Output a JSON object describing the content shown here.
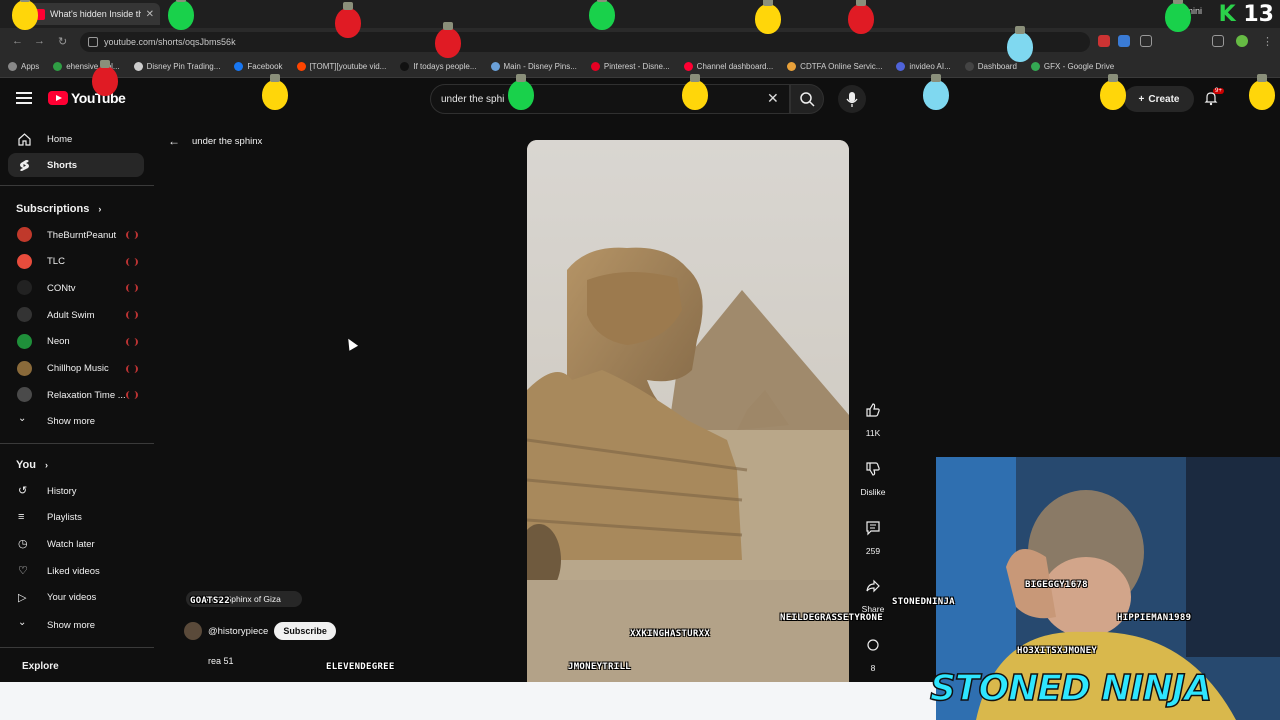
{
  "browser": {
    "tab_title": "What's hidden Inside th",
    "url": "youtube.com/shorts/oqsJbms56k",
    "gemini_label": "Gemini",
    "overlay_counter": "13",
    "bookmarks": [
      {
        "label": "Apps"
      },
      {
        "label": "ehensive Gol..."
      },
      {
        "label": "Disney Pin Trading..."
      },
      {
        "label": "Facebook"
      },
      {
        "label": "[TOMT][youtube vid..."
      },
      {
        "label": "If todays people..."
      },
      {
        "label": "Main - Disney Pins..."
      },
      {
        "label": "Pinterest - Disne..."
      },
      {
        "label": "Channel dashboard..."
      },
      {
        "label": "CDTFA Online Servic..."
      },
      {
        "label": "invideo AI..."
      },
      {
        "label": "Dashboard"
      },
      {
        "label": "GFX - Google Drive"
      }
    ]
  },
  "youtube": {
    "logo_text": "YouTube",
    "search_value": "under the sphi",
    "create_label": "Create",
    "notif_badge": "9+"
  },
  "sidebar": {
    "top": [
      {
        "label": "Home",
        "icon": "home-icon"
      },
      {
        "label": "Shorts",
        "icon": "shorts-icon",
        "active": true
      }
    ],
    "subscriptions_header": "Subscriptions",
    "subscriptions": [
      {
        "label": "TheBurntPeanut",
        "color": "#c0392b"
      },
      {
        "label": "TLC",
        "color": "#e74c3c"
      },
      {
        "label": "CONtv",
        "color": "#222222"
      },
      {
        "label": "Adult Swim",
        "color": "#333333"
      },
      {
        "label": "Neon",
        "color": "#1f8f3a"
      },
      {
        "label": "Chillhop Music",
        "color": "#8a6a3a"
      },
      {
        "label": "Relaxation Time ...",
        "color": "#4a4a4a"
      }
    ],
    "show_more": "Show more",
    "you_header": "You",
    "you_items": [
      {
        "label": "History",
        "icon": "history-icon"
      },
      {
        "label": "Playlists",
        "icon": "playlists-icon"
      },
      {
        "label": "Watch later",
        "icon": "watch-later-icon"
      },
      {
        "label": "Liked videos",
        "icon": "liked-icon"
      },
      {
        "label": "Your videos",
        "icon": "your-videos-icon"
      }
    ],
    "show_more_2": "Show more",
    "explore_header": "Explore"
  },
  "main": {
    "back_label": "under the sphinx",
    "likes": "11K",
    "dislike_label": "Dislike",
    "comments": "259",
    "share_label": "Share",
    "remix_count": "8",
    "location_chip": "Great Sphinx of Giza",
    "channel_handle": "@historypiece",
    "subscribe_label": "Subscribe",
    "title_fragment": "rea 51"
  },
  "stream": {
    "name": "STONED NINJA",
    "nicknames": [
      "GOATS22",
      "BIGEGGY1678",
      "STONEDNINJA",
      "NEILDEGRASSETYRONE",
      "HIPPIEMAN1989",
      "XXKINGHASTURXX",
      "HO3XITSXJMONEY",
      "JMONEYTRILL",
      "ELEVENDEGREE"
    ]
  }
}
